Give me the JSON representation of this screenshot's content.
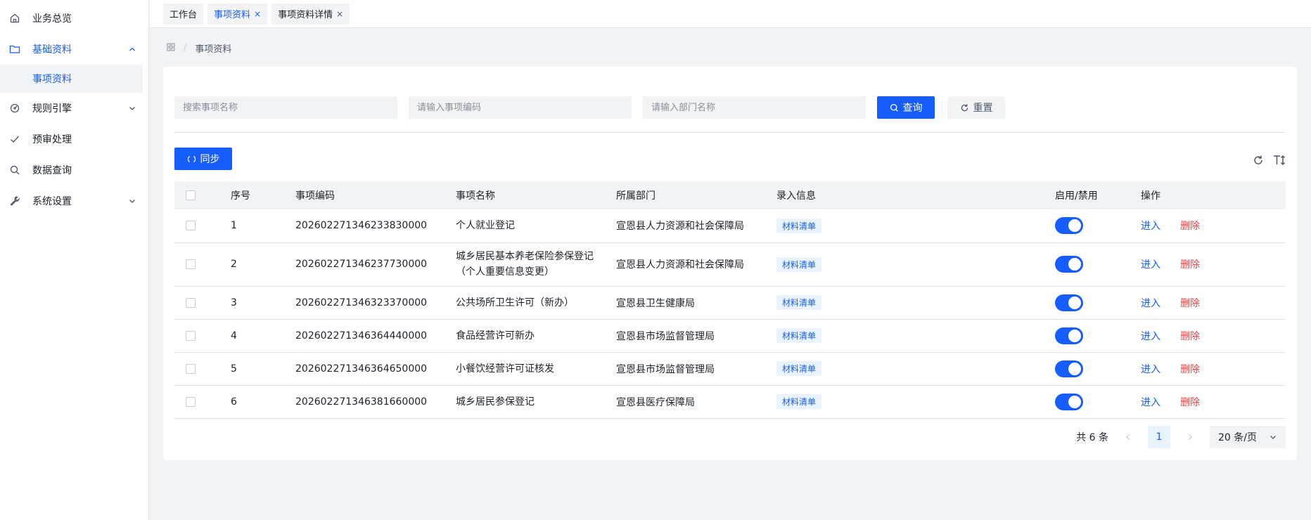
{
  "sidebar": {
    "items": [
      {
        "label": "业务总览",
        "icon": "home-icon"
      },
      {
        "label": "基础资料",
        "icon": "folder-icon",
        "expanded": true
      },
      {
        "label": "规则引擎",
        "icon": "engine-icon"
      },
      {
        "label": "预审处理",
        "icon": "check-icon"
      },
      {
        "label": "数据查询",
        "icon": "search-icon"
      },
      {
        "label": "系统设置",
        "icon": "wrench-icon"
      }
    ],
    "sub_item": "事项资料"
  },
  "tabs": [
    {
      "label": "工作台"
    },
    {
      "label": "事项资料",
      "close": "×"
    },
    {
      "label": "事项资料详情",
      "close": "×"
    }
  ],
  "breadcrumb": {
    "icon": "apps-icon",
    "separator": "/",
    "current": "事项资料"
  },
  "search": {
    "name_placeholder": "搜索事项名称",
    "code_placeholder": "请输入事项编码",
    "dept_placeholder": "请输入部门名称",
    "query_label": "查询",
    "reset_label": "重置"
  },
  "toolbar": {
    "sync_label": "同步"
  },
  "table": {
    "columns": [
      "序号",
      "事项编码",
      "事项名称",
      "所属部门",
      "录入信息",
      "启用/禁用",
      "操作"
    ],
    "rows": [
      {
        "index": "1",
        "code": "20260227134623383000​0",
        "name": "个人就业登记",
        "dept": "宣恩县人力资源和社会保障局",
        "info": "材料清单"
      },
      {
        "index": "2",
        "code": "202602271346237730000",
        "name": "城乡居民基本养老保险参保登记（个人重要信息变更）",
        "dept": "宣恩县人力资源和社会保障局",
        "info": "材料清单"
      },
      {
        "index": "3",
        "code": "202602271346323370000",
        "name": "公共场所卫生许可（新办）",
        "dept": "宣恩县卫生健康局",
        "info": "材料清单"
      },
      {
        "index": "4",
        "code": "202602271346364440000",
        "name": "食品经营许可新办",
        "dept": "宣恩县市场监督管理局",
        "info": "材料清单"
      },
      {
        "index": "5",
        "code": "202602271346364650000",
        "name": "小餐饮经营许可证核发",
        "dept": "宣恩县市场监督管理局",
        "info": "材料清单"
      },
      {
        "index": "6",
        "code": "202602271346381660000",
        "name": "城乡居民参保登记",
        "dept": "宣恩县医疗保障局",
        "info": "材料清单"
      }
    ],
    "enter_label": "进入",
    "delete_label": "删除"
  },
  "pagination": {
    "total": "共 6 条",
    "page": "1",
    "page_size": "20 条/页"
  },
  "colors": {
    "primary": "#165dff",
    "danger": "#f53f3f"
  }
}
